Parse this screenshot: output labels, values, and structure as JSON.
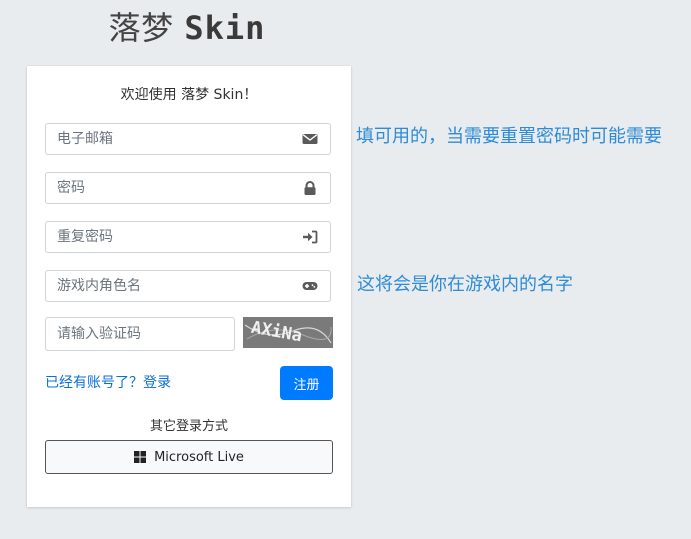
{
  "brand": {
    "name_cn": "落梦",
    "name_skin": "Skin"
  },
  "card": {
    "welcome": "欢迎使用 落梦 Skin！",
    "fields": {
      "email": {
        "placeholder": "电子邮箱",
        "icon": "envelope-icon"
      },
      "password": {
        "placeholder": "密码",
        "icon": "lock-icon"
      },
      "confirm_password": {
        "placeholder": "重复密码",
        "icon": "sign-in-icon"
      },
      "player_name": {
        "placeholder": "游戏内角色名",
        "icon": "gamepad-icon"
      },
      "captcha": {
        "placeholder": "请输入验证码"
      }
    },
    "captcha_image_text": "AXiNa",
    "login_link": "已经有账号了？登录",
    "register_button": "注册",
    "other_login_title": "其它登录方式",
    "microsoft_button": "Microsoft Live"
  },
  "annotations": {
    "email_note": "填可用的，当需要重置密码时可能需要",
    "player_name_note": "这将会是你在游戏内的名字"
  },
  "colors": {
    "background": "#e9ecef",
    "primary": "#007bff",
    "link": "#0b6fd8",
    "annotation": "#2e8bd6",
    "icon": "#5a5a5a"
  }
}
